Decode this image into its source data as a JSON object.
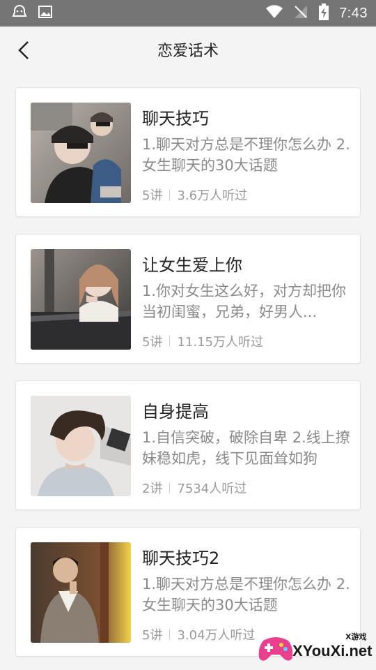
{
  "status_bar": {
    "time": "7:43"
  },
  "header": {
    "title": "恋爱话术"
  },
  "courses": [
    {
      "title": "聊天技巧",
      "description": "1.聊天对方总是不理你怎么办 2.女生聊天的30大话题",
      "lessons": "5讲",
      "listeners": "3.6万人听过"
    },
    {
      "title": "让女生爱上你",
      "description": "1.你对女生这么好，对方却把你当初闺蜜，兄弟，好男人...",
      "lessons": "5讲",
      "listeners": "11.15万人听过"
    },
    {
      "title": "自身提高",
      "description": "1.自信突破，破除自卑 2.线上撩妹稳如虎，线下见面耸如狗",
      "lessons": "2讲",
      "listeners": "7534人听过"
    },
    {
      "title": "聊天技巧2",
      "description": "1.聊天对方总是不理你怎么办 2.女生聊天的30大话题",
      "lessons": "5讲",
      "listeners": "3.04万人听过"
    }
  ],
  "watermark": {
    "text": "XYouXi.net",
    "small": "X游戏"
  }
}
